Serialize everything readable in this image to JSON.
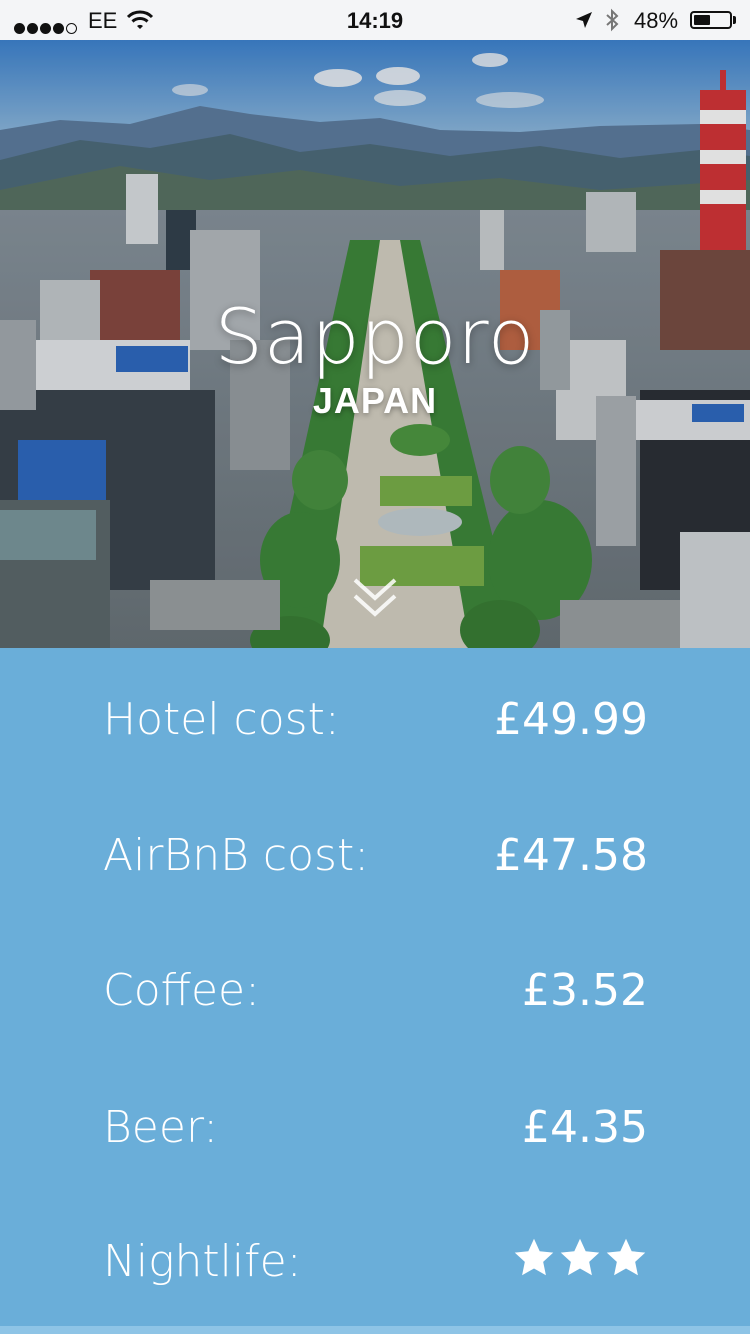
{
  "status_bar": {
    "carrier": "EE",
    "time": "14:19",
    "battery_percent": "48%",
    "battery_level": 0.48,
    "signal_bars": 4,
    "signal_total": 5
  },
  "hero": {
    "city": "Sapporo",
    "country": "JAPAN",
    "scroll_icon": "double-chevron-down-icon"
  },
  "costs": [
    {
      "label": "Hotel cost:",
      "value": "£49.99"
    },
    {
      "label": "AirBnB cost:",
      "value": "£47.58"
    },
    {
      "label": "Coffee:",
      "value": "£3.52"
    },
    {
      "label": "Beer:",
      "value": "£4.35"
    }
  ],
  "nightlife": {
    "label": "Nightlife:",
    "rating": 3,
    "icon": "star-icon"
  },
  "colors": {
    "panel_background": "#6aaed9",
    "text": "#ffffff",
    "status_bar_background": "#f4f5f7"
  }
}
